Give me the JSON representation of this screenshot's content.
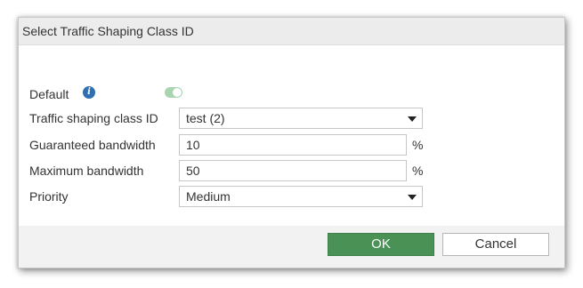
{
  "dialog": {
    "title": "Select Traffic Shaping Class ID"
  },
  "form": {
    "default": {
      "label": "Default",
      "info_icon": "info-icon",
      "toggle_on": true
    },
    "class_id": {
      "label": "Traffic shaping class ID",
      "value": "test (2)"
    },
    "guaranteed": {
      "label": "Guaranteed bandwidth",
      "value": "10",
      "unit": "%"
    },
    "maximum": {
      "label": "Maximum bandwidth",
      "value": "50",
      "unit": "%"
    },
    "priority": {
      "label": "Priority",
      "value": "Medium"
    }
  },
  "footer": {
    "ok_label": "OK",
    "cancel_label": "Cancel"
  },
  "colors": {
    "ok_button": "#4a9156",
    "toggle_on": "#a8d5b0",
    "info_icon": "#2f6fb3",
    "header_bg": "#ececec"
  }
}
